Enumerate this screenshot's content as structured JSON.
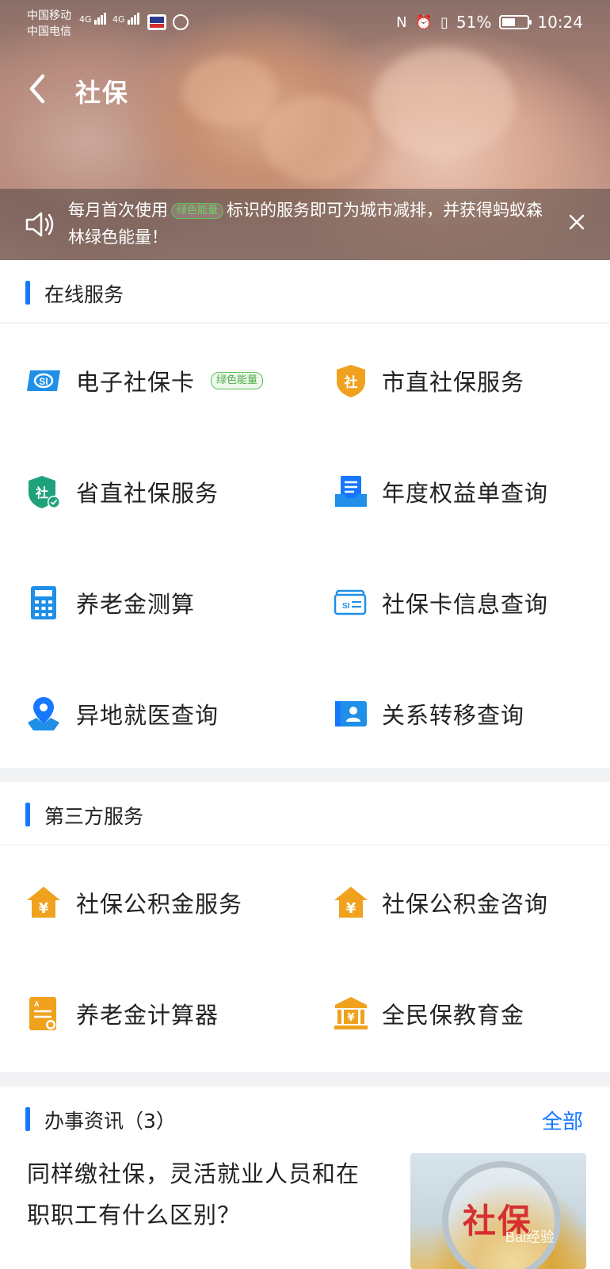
{
  "status_bar": {
    "carrier_1": "中国移动",
    "carrier_2": "中国电信",
    "net_1": "4G",
    "net_2": "4G",
    "battery": "51%",
    "time": "10:24"
  },
  "nav": {
    "title": "社保"
  },
  "notice": {
    "text_before": "每月首次使用",
    "tag": "绿色能量",
    "text_after": "标识的服务即可为城市减排，并获得蚂蚁森林绿色能量！"
  },
  "online_services": {
    "title": "在线服务",
    "items": [
      {
        "label": "电子社保卡",
        "icon": "si-card-icon",
        "tag": "绿色能量"
      },
      {
        "label": "市直社保服务",
        "icon": "shield-she-icon"
      },
      {
        "label": "省直社保服务",
        "icon": "shield-check-icon"
      },
      {
        "label": "年度权益单查询",
        "icon": "document-tray-icon"
      },
      {
        "label": "养老金测算",
        "icon": "calculator-icon"
      },
      {
        "label": "社保卡信息查询",
        "icon": "si-card-outline-icon"
      },
      {
        "label": "异地就医查询",
        "icon": "map-pin-icon"
      },
      {
        "label": "关系转移查询",
        "icon": "contact-card-icon"
      }
    ]
  },
  "third_party": {
    "title": "第三方服务",
    "items": [
      {
        "label": "社保公积金服务",
        "icon": "house-yuan-icon"
      },
      {
        "label": "社保公积金咨询",
        "icon": "house-yuan-icon"
      },
      {
        "label": "养老金计算器",
        "icon": "certificate-icon"
      },
      {
        "label": "全民保教育金",
        "icon": "bank-icon"
      }
    ]
  },
  "news": {
    "title": "办事资讯（3）",
    "more": "全部",
    "items": [
      {
        "title": "同样缴社保，灵活就业人员和在职职工有什么区别？",
        "thumb_text": "社保",
        "thumb_watermark": "Bai经验"
      }
    ]
  },
  "colors": {
    "accent": "#1677ff",
    "orange": "#f0a21e",
    "green": "#5cbf56"
  }
}
